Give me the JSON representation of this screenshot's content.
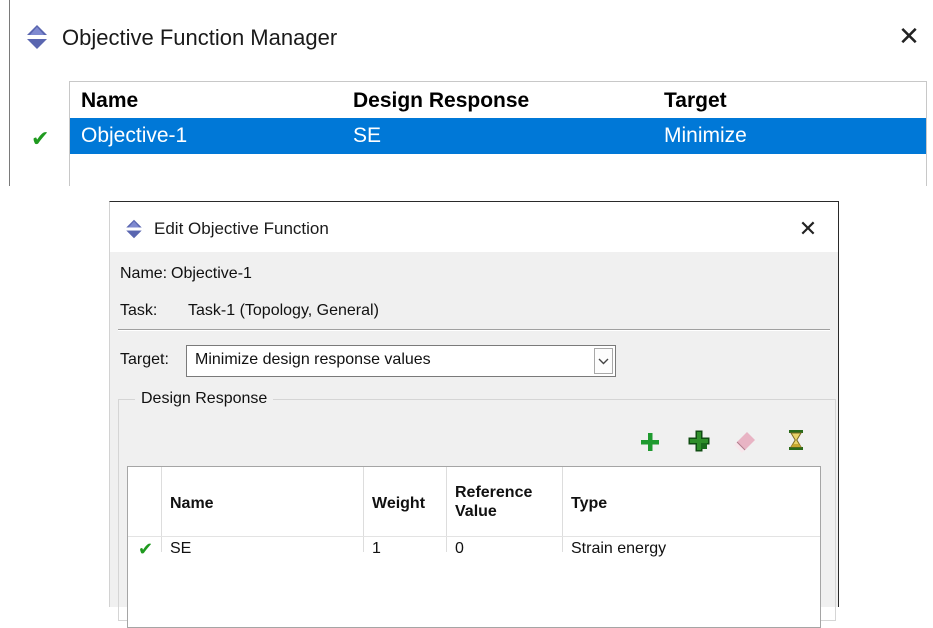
{
  "manager": {
    "title": "Objective Function Manager",
    "close_glyph": "✕",
    "columns": [
      "Name",
      "Design Response",
      "Target"
    ],
    "rows": [
      {
        "checked": true,
        "check_glyph": "✔",
        "name": "Objective-1",
        "design_response": "SE",
        "target": "Minimize",
        "selected": true
      }
    ],
    "icon": "abaqus-diamond-icon",
    "selection_color": "#0078d7"
  },
  "edit_dialog": {
    "title": "Edit Objective Function",
    "close_glyph": "✕",
    "name_label": "Name:",
    "name_value": "Objective-1",
    "task_label": "Task:",
    "task_value": "Task-1 (Topology, General)",
    "target_label": "Target:",
    "target_value": "Minimize design response values",
    "group_title": "Design Response",
    "toolbar": [
      {
        "icon": "add-icon"
      },
      {
        "icon": "add-from-selection-icon"
      },
      {
        "icon": "eraser-icon"
      },
      {
        "icon": "hourglass-icon"
      }
    ],
    "table": {
      "columns": [
        "Name",
        "Weight",
        "Reference Value",
        "Type"
      ],
      "rows": [
        {
          "checked": true,
          "check_glyph": "✔",
          "name": "SE",
          "weight": "1",
          "reference_value": "0",
          "type": "Strain energy"
        }
      ]
    }
  }
}
